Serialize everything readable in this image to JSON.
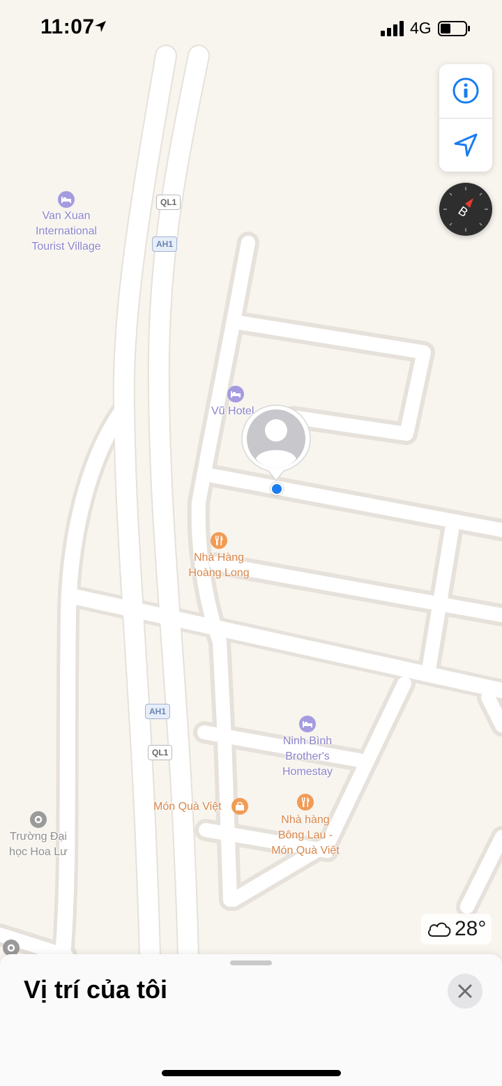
{
  "status_bar": {
    "time": "11:07",
    "network": "4G",
    "icons": [
      "location-arrow-icon",
      "signal-bars-icon",
      "battery-icon"
    ]
  },
  "map_controls": {
    "info_icon": "info-icon",
    "locate_icon": "location-arrow-icon",
    "compass_letter": "B"
  },
  "route_shields": [
    {
      "text": "QL1"
    },
    {
      "text": "AH1"
    },
    {
      "text": "AH1"
    },
    {
      "text": "QL1"
    }
  ],
  "pois": [
    {
      "name": "Van Xuan\nInternational\nTourist Village",
      "category": "hotel",
      "icon": "bed-icon"
    },
    {
      "name": "Vũ Hotel",
      "category": "hotel",
      "icon": "bed-icon"
    },
    {
      "name": "Nhà Hàng\nHoàng Long",
      "category": "restaurant",
      "icon": "fork-knife-icon"
    },
    {
      "name": "Ninh Bình\nBrother's\nHomestay",
      "category": "hotel",
      "icon": "bed-icon"
    },
    {
      "name": "Món Quà Việt",
      "category": "shop",
      "icon": "bag-icon"
    },
    {
      "name": "Nhà hàng\nBông Lau -\nMón Quà Việt",
      "category": "restaurant",
      "icon": "fork-knife-icon"
    },
    {
      "name": "Trường Đại\nhọc Hoa Lư",
      "category": "school",
      "icon": "school-icon"
    }
  ],
  "weather": {
    "icon": "cloud-icon",
    "temperature": "28°"
  },
  "sheet": {
    "title": "Vị trí của tôi",
    "close_icon": "close-icon"
  },
  "colors": {
    "map_background": "#f8f4ee",
    "road": "#ffffff",
    "hotel": "#8c84c9",
    "restaurant": "#d9864a",
    "user_location": "#1a7cf0"
  }
}
